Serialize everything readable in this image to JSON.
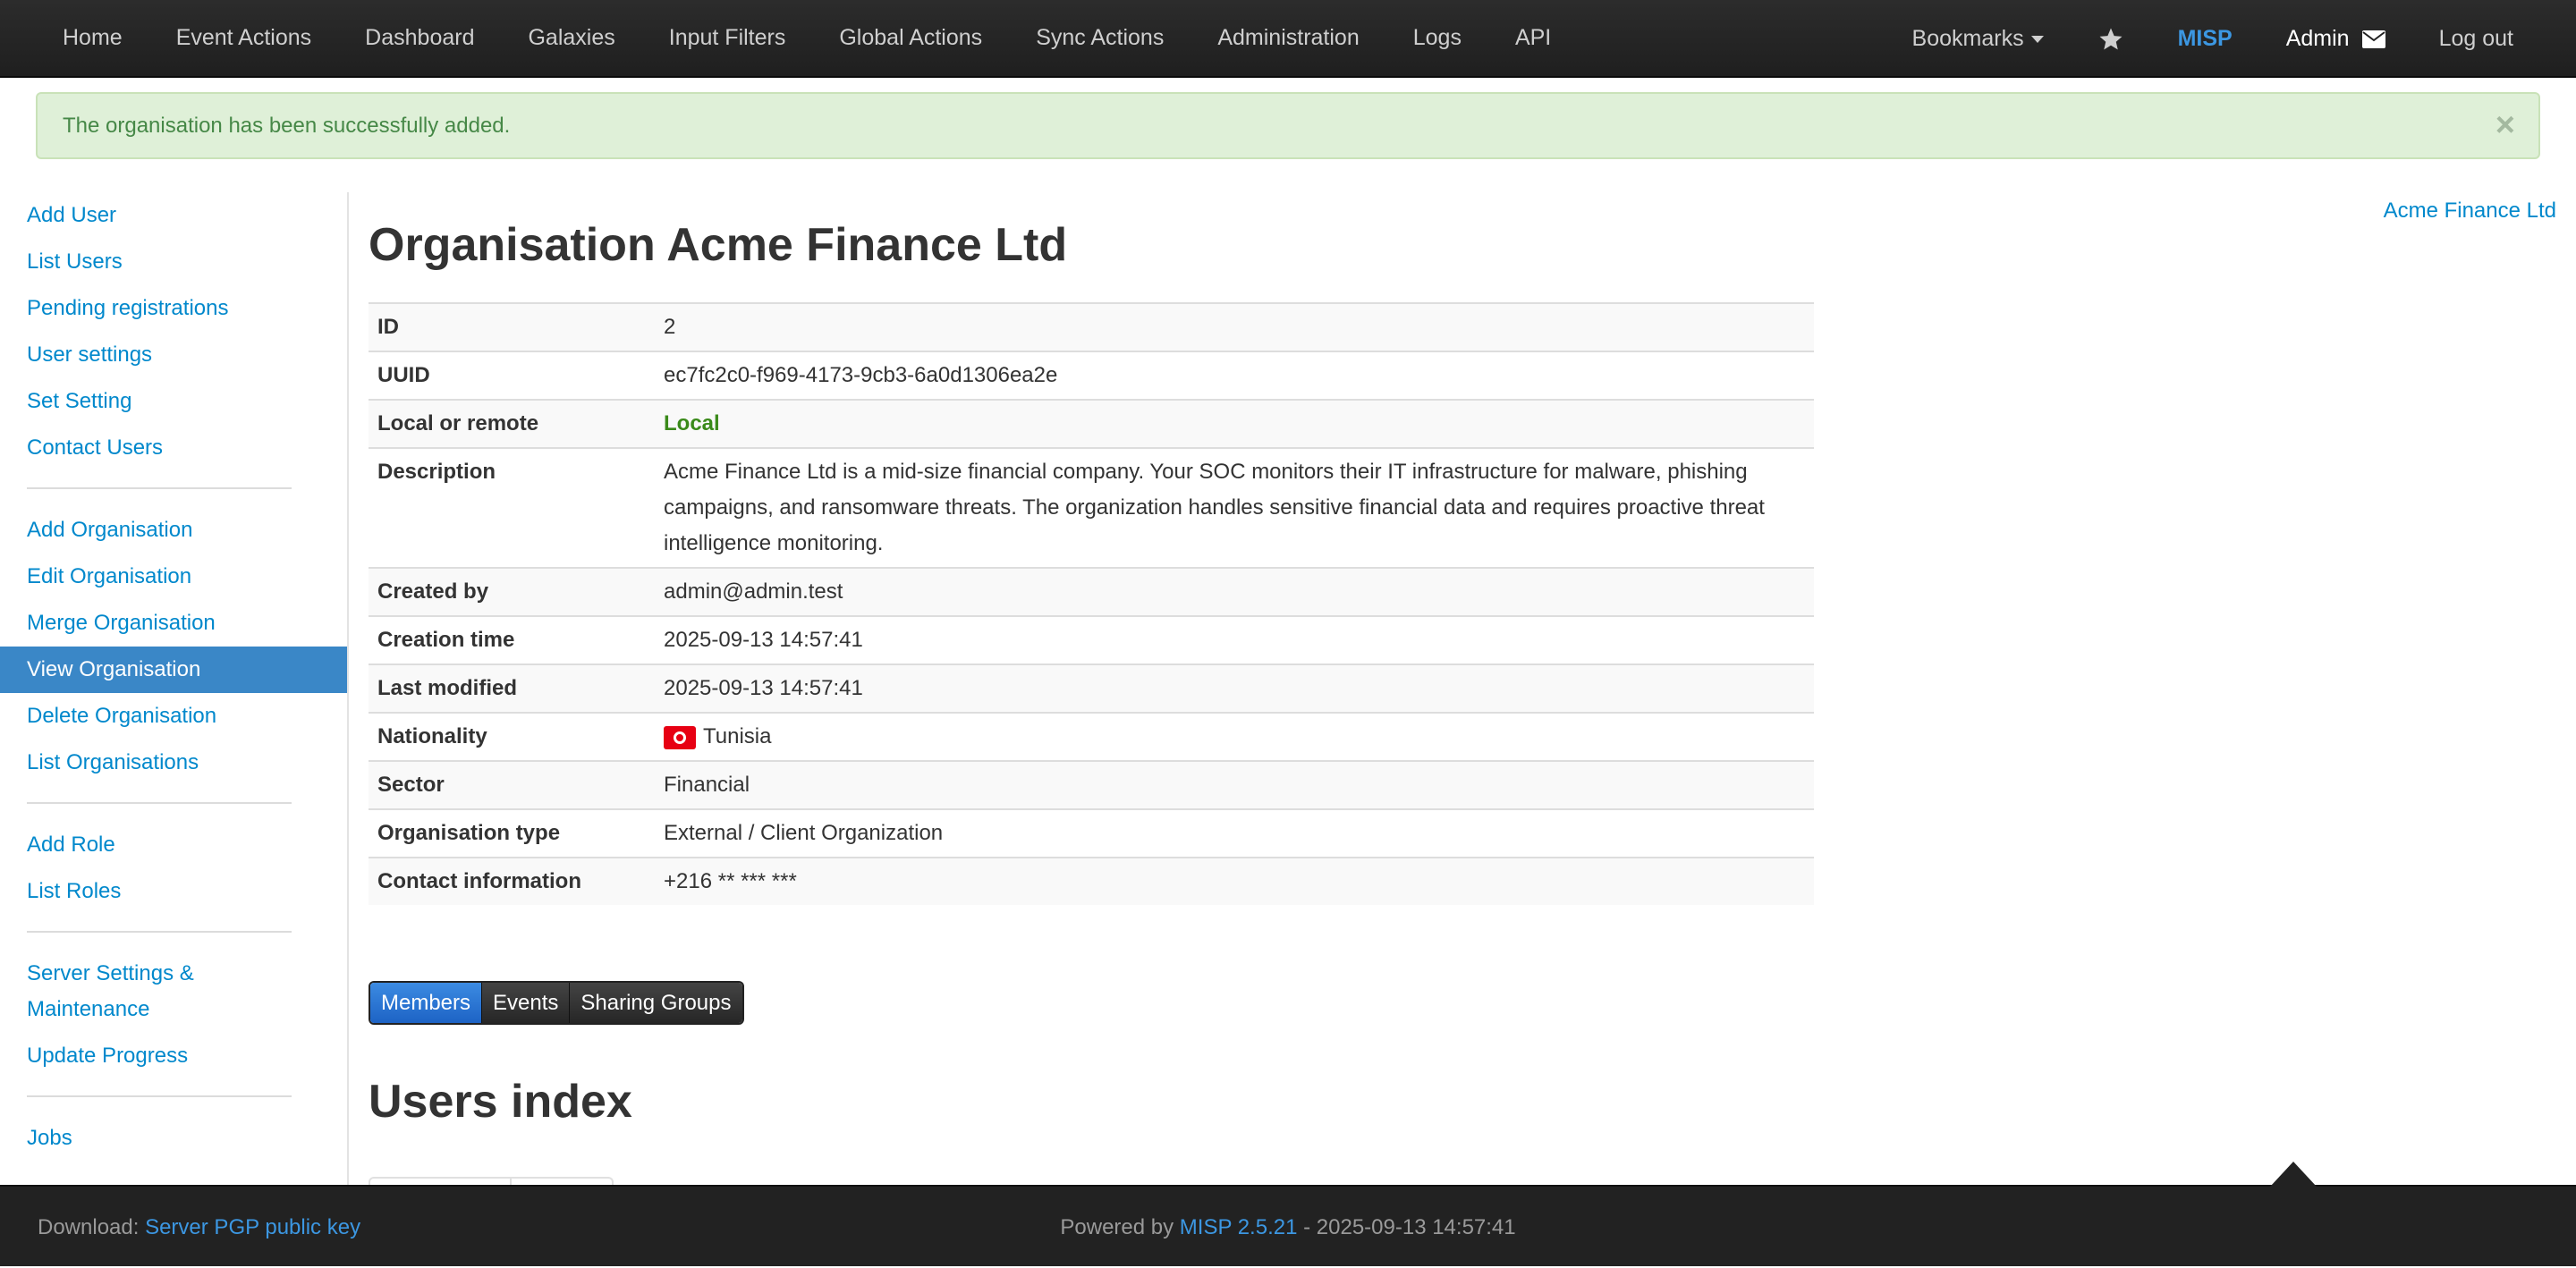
{
  "navbar": {
    "items": [
      "Home",
      "Event Actions",
      "Dashboard",
      "Galaxies",
      "Input Filters",
      "Global Actions",
      "Sync Actions",
      "Administration",
      "Logs",
      "API"
    ],
    "bookmarks": "Bookmarks",
    "misp": "MISP",
    "admin": "Admin",
    "logout": "Log out"
  },
  "alert": {
    "message": "The organisation has been successfully added.",
    "close": "×"
  },
  "sidebar": {
    "groups": [
      [
        "Add User",
        "List Users",
        "Pending registrations",
        "User settings",
        "Set Setting",
        "Contact Users"
      ],
      [
        "Add Organisation",
        "Edit Organisation",
        "Merge Organisation",
        "View Organisation",
        "Delete Organisation",
        "List Organisations"
      ],
      [
        "Add Role",
        "List Roles"
      ],
      [
        "Server Settings & Maintenance",
        "Update Progress"
      ],
      [
        "Jobs"
      ]
    ],
    "active": "View Organisation"
  },
  "org_link": "Acme Finance Ltd",
  "page_title": "Organisation Acme Finance Ltd",
  "details": [
    {
      "key": "ID",
      "value": "2"
    },
    {
      "key": "UUID",
      "value": "ec7fc2c0-f969-4173-9cb3-6a0d1306ea2e"
    },
    {
      "key": "Local or remote",
      "value": "Local"
    },
    {
      "key": "Description",
      "value": "Acme Finance Ltd is a mid-size financial company. Your SOC monitors their IT infrastructure for malware, phishing campaigns, and ransomware threats. The organization handles sensitive financial data and requires proactive threat intelligence monitoring."
    },
    {
      "key": "Created by",
      "value": "admin@admin.test"
    },
    {
      "key": "Creation time",
      "value": "2025-09-13 14:57:41"
    },
    {
      "key": "Last modified",
      "value": "2025-09-13 14:57:41"
    },
    {
      "key": "Nationality",
      "value": "Tunisia"
    },
    {
      "key": "Sector",
      "value": "Financial"
    },
    {
      "key": "Organisation type",
      "value": "External / Client Organization"
    },
    {
      "key": "Contact information",
      "value": "+216 ** *** ***"
    }
  ],
  "tabs": [
    "Members",
    "Events",
    "Sharing Groups"
  ],
  "users_index_title": "Users index",
  "footer": {
    "download_label": "Download:",
    "pgp_link": "Server PGP public key",
    "powered_by": "Powered by",
    "misp_version": "MISP 2.5.21",
    "timestamp": "- 2025-09-13 14:57:41"
  },
  "colors": {
    "link": "#0088cc",
    "active_sidebar": "#3a87c7",
    "success_bg": "#dff0d8",
    "local_green": "#3a8a1a",
    "navbar": "#222222"
  }
}
